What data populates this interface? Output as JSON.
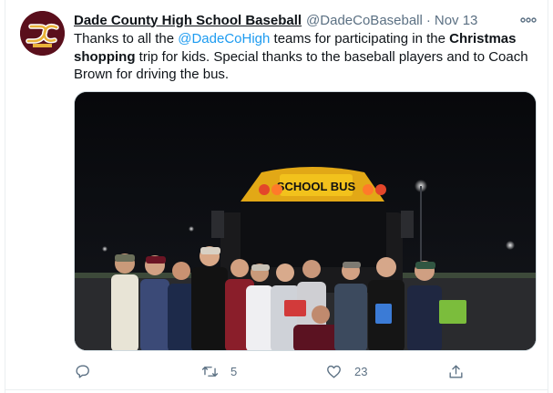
{
  "tweet": {
    "display_name": "Dade County High School Baseball",
    "handle": "@DadeCoBaseball",
    "separator": "·",
    "timestamp": "Nov 13",
    "more_icon": "more-horizontal-icon",
    "avatar": {
      "logo_text": "DC",
      "label": "WOLVERINES",
      "colors": {
        "background": "#5a0f1c",
        "gold": "#e9b23a"
      }
    },
    "text_parts": {
      "p1": "Thanks to all the ",
      "mention": "@DadeCoHigh",
      "p2": " teams for participating in the ",
      "bold": "Christmas shopping",
      "p3": " trip for kids. Special thanks to the baseball players and to Coach Brown for driving the bus."
    },
    "photo": {
      "description_icon": "photo-image",
      "bus_sign": "SCHOOL BUS"
    },
    "actions": {
      "reply": {
        "icon": "reply-icon",
        "count": ""
      },
      "retweet": {
        "icon": "retweet-icon",
        "count": "5"
      },
      "like": {
        "icon": "heart-icon",
        "count": "23"
      },
      "share": {
        "icon": "share-icon",
        "count": ""
      }
    },
    "colors": {
      "link": "#1d9bf0",
      "muted": "#5b7083",
      "border": "#ebeef0"
    }
  }
}
